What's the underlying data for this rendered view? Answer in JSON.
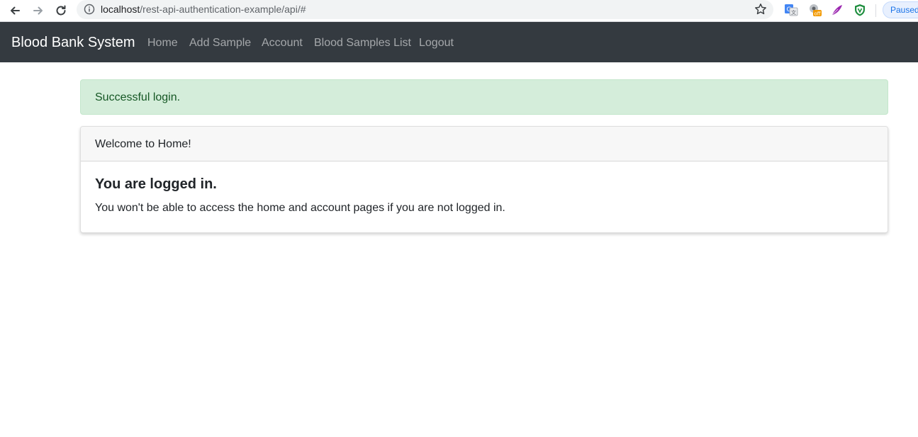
{
  "browser": {
    "url_host": "localhost",
    "url_path": "/rest-api-authentication-example/api/#",
    "profile_status": "Paused",
    "extensions": [
      "google-translate-icon",
      "extension-off-icon",
      "quill-icon",
      "shield-extension-icon"
    ]
  },
  "navbar": {
    "brand": "Blood Bank System",
    "links": [
      {
        "label": "Home"
      },
      {
        "label": "Add Sample"
      },
      {
        "label": "Account"
      },
      {
        "label": "Blood Samples List"
      },
      {
        "label": "Logout"
      }
    ],
    "background_color": "#343a40"
  },
  "alert": {
    "message": "Successful login.",
    "color": "#d4edda"
  },
  "card": {
    "header": "Welcome to Home!",
    "title": "You are logged in.",
    "text": "You won't be able to access the home and account pages if you are not logged in."
  }
}
